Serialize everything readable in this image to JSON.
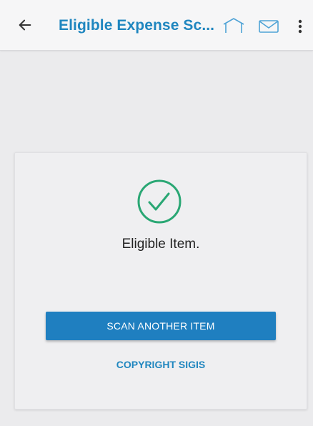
{
  "header": {
    "title": "Eligible Expense Sc...",
    "back_icon": "arrow-left-icon",
    "home_icon": "home-icon",
    "mail_icon": "mail-icon",
    "more_icon": "more-vertical-icon"
  },
  "result": {
    "status_icon": "check-circle-icon",
    "message": "Eligible Item."
  },
  "actions": {
    "scan_another_label": "SCAN ANOTHER ITEM",
    "copyright_label": "COPYRIGHT SIGIS"
  },
  "colors": {
    "accent": "#1f86bf",
    "button": "#1f7fc0",
    "success": "#2aa774"
  }
}
